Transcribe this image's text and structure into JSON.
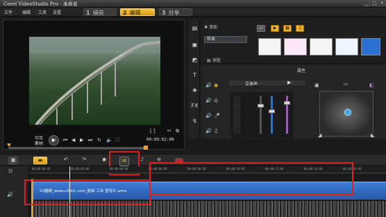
{
  "window": {
    "title": "Corel VideoStudio Pro - 未命名"
  },
  "menu": [
    "文件",
    "编辑",
    "工具",
    "设置"
  ],
  "steps": [
    {
      "num": "1",
      "label": "捕获",
      "active": false
    },
    {
      "num": "2",
      "label": "编辑",
      "active": true
    },
    {
      "num": "3",
      "label": "分享",
      "active": false
    }
  ],
  "preview": {
    "project_label": "项目",
    "clip_label": "素材",
    "timecode": "00:00:02:00",
    "in_out": "[ ]",
    "progress_fraction": 0.0
  },
  "library": {
    "add_label": "添加",
    "folder_name": "样本",
    "browse_label": "浏览",
    "filter_icons": [
      "folder-icon",
      "video-filter-icon",
      "photo-filter-icon",
      "audio-filter-icon"
    ]
  },
  "attributes": {
    "title": "属性",
    "tab_label": "立体声"
  },
  "timeline": {
    "ruler_labels": [
      "00:00:00:00",
      "00:00:02:00",
      "00:00:04:00",
      "00:00:06:00",
      "00:00:08:00",
      "00:00:10:00",
      "00:00:12:00",
      "00:00:14:00",
      "00:00:16:00"
    ],
    "clip_label": "V3摄网_www.v3sh1.com_航拍 工业 宣传片.wmv"
  },
  "colors": {
    "accent": "#f0a030",
    "highlight": "#e02020",
    "clip_blue": "#2f6bc2"
  }
}
